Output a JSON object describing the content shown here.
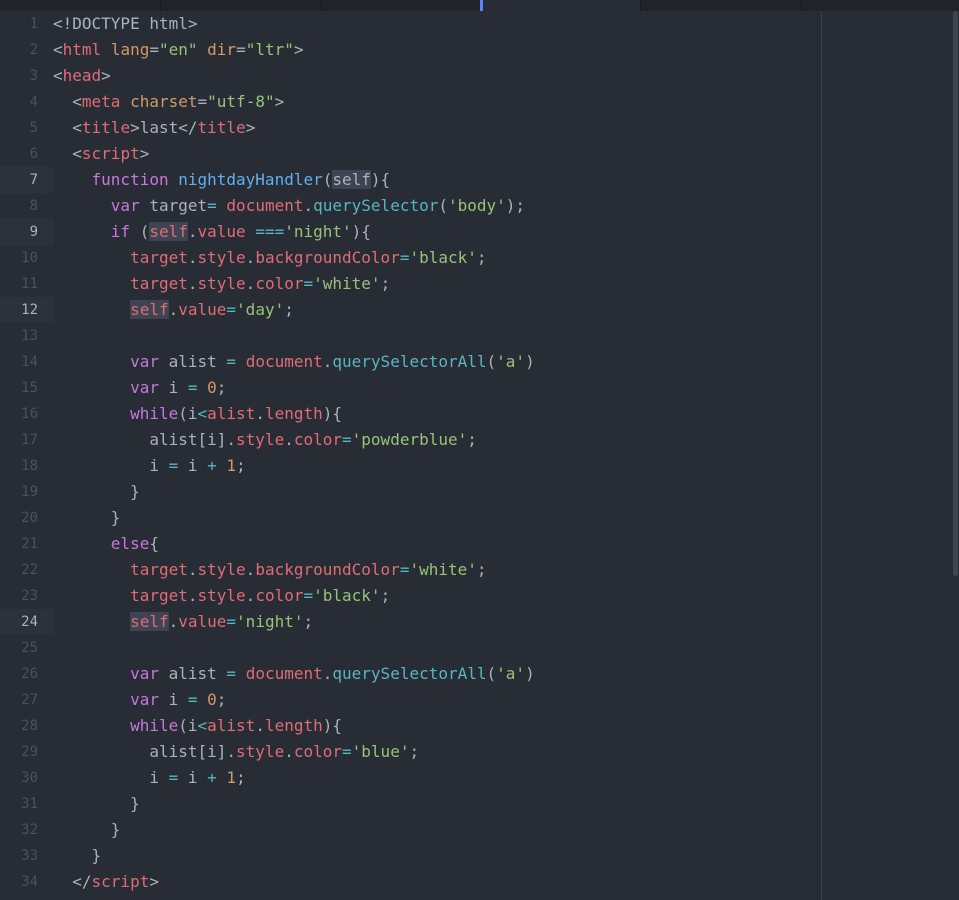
{
  "colors": {
    "background": "#282c34",
    "tag": "#e06c75",
    "attribute": "#d19a66",
    "string": "#98c379",
    "keyword": "#c678dd",
    "function": "#61afef",
    "method": "#56b6c2",
    "text": "#abb2bf",
    "line_number": "#495162",
    "selection": "#3e4451"
  },
  "lines": [
    {
      "n": "1",
      "hl": false,
      "tokens": [
        [
          "p",
          "<!DOCTYPE html>"
        ]
      ]
    },
    {
      "n": "2",
      "hl": false,
      "tokens": [
        [
          "p",
          "<"
        ],
        [
          "tag",
          "html"
        ],
        [
          "p",
          " "
        ],
        [
          "attr",
          "lang"
        ],
        [
          "p",
          "="
        ],
        [
          "str",
          "\"en\""
        ],
        [
          "p",
          " "
        ],
        [
          "attr",
          "dir"
        ],
        [
          "p",
          "="
        ],
        [
          "str",
          "\"ltr\""
        ],
        [
          "p",
          ">"
        ]
      ]
    },
    {
      "n": "3",
      "hl": false,
      "tokens": [
        [
          "p",
          "<"
        ],
        [
          "tag",
          "head"
        ],
        [
          "p",
          ">"
        ]
      ]
    },
    {
      "n": "4",
      "hl": false,
      "tokens": [
        [
          "p",
          "  <"
        ],
        [
          "tag",
          "meta"
        ],
        [
          "p",
          " "
        ],
        [
          "attr",
          "charset"
        ],
        [
          "p",
          "="
        ],
        [
          "str",
          "\"utf-8\""
        ],
        [
          "p",
          ">"
        ]
      ]
    },
    {
      "n": "5",
      "hl": false,
      "tokens": [
        [
          "p",
          "  <"
        ],
        [
          "tag",
          "title"
        ],
        [
          "p",
          ">last</"
        ],
        [
          "tag",
          "title"
        ],
        [
          "p",
          ">"
        ]
      ]
    },
    {
      "n": "6",
      "hl": false,
      "tokens": [
        [
          "p",
          "  <"
        ],
        [
          "tag",
          "script"
        ],
        [
          "p",
          ">"
        ]
      ]
    },
    {
      "n": "7",
      "hl": true,
      "tokens": [
        [
          "p",
          "    "
        ],
        [
          "kw",
          "function"
        ],
        [
          "p",
          " "
        ],
        [
          "fn",
          "nightdayHandler"
        ],
        [
          "p",
          "("
        ],
        [
          "selp",
          "self"
        ],
        [
          "p",
          "){"
        ]
      ]
    },
    {
      "n": "8",
      "hl": false,
      "tokens": [
        [
          "p",
          "      "
        ],
        [
          "kw",
          "var"
        ],
        [
          "p",
          " target"
        ],
        [
          "op",
          "="
        ],
        [
          "p",
          " "
        ],
        [
          "prop",
          "document"
        ],
        [
          "p",
          "."
        ],
        [
          "met",
          "querySelector"
        ],
        [
          "p",
          "("
        ],
        [
          "str",
          "'body'"
        ],
        [
          "p",
          ");"
        ]
      ]
    },
    {
      "n": "9",
      "hl": true,
      "tokens": [
        [
          "p",
          "      "
        ],
        [
          "kw",
          "if"
        ],
        [
          "p",
          " ("
        ],
        [
          "self",
          "self"
        ],
        [
          "p",
          "."
        ],
        [
          "prop",
          "value"
        ],
        [
          "p",
          " "
        ],
        [
          "op",
          "==="
        ],
        [
          "str",
          "'night'"
        ],
        [
          "p",
          "){"
        ]
      ]
    },
    {
      "n": "10",
      "hl": false,
      "tokens": [
        [
          "p",
          "        "
        ],
        [
          "prop",
          "target"
        ],
        [
          "p",
          "."
        ],
        [
          "prop",
          "style"
        ],
        [
          "p",
          "."
        ],
        [
          "prop",
          "backgroundColor"
        ],
        [
          "op",
          "="
        ],
        [
          "str",
          "'black'"
        ],
        [
          "p",
          ";"
        ]
      ]
    },
    {
      "n": "11",
      "hl": false,
      "tokens": [
        [
          "p",
          "        "
        ],
        [
          "prop",
          "target"
        ],
        [
          "p",
          "."
        ],
        [
          "prop",
          "style"
        ],
        [
          "p",
          "."
        ],
        [
          "prop",
          "color"
        ],
        [
          "op",
          "="
        ],
        [
          "str",
          "'white'"
        ],
        [
          "p",
          ";"
        ]
      ]
    },
    {
      "n": "12",
      "hl": true,
      "tokens": [
        [
          "p",
          "        "
        ],
        [
          "self",
          "self"
        ],
        [
          "p",
          "."
        ],
        [
          "prop",
          "value"
        ],
        [
          "op",
          "="
        ],
        [
          "str",
          "'day'"
        ],
        [
          "p",
          ";"
        ]
      ]
    },
    {
      "n": "13",
      "hl": false,
      "tokens": []
    },
    {
      "n": "14",
      "hl": false,
      "tokens": [
        [
          "p",
          "        "
        ],
        [
          "kw",
          "var"
        ],
        [
          "p",
          " alist "
        ],
        [
          "op",
          "="
        ],
        [
          "p",
          " "
        ],
        [
          "prop",
          "document"
        ],
        [
          "p",
          "."
        ],
        [
          "met",
          "querySelectorAll"
        ],
        [
          "p",
          "("
        ],
        [
          "str",
          "'a'"
        ],
        [
          "p",
          ")"
        ]
      ]
    },
    {
      "n": "15",
      "hl": false,
      "tokens": [
        [
          "p",
          "        "
        ],
        [
          "kw",
          "var"
        ],
        [
          "p",
          " i "
        ],
        [
          "op",
          "="
        ],
        [
          "p",
          " "
        ],
        [
          "num",
          "0"
        ],
        [
          "p",
          ";"
        ]
      ]
    },
    {
      "n": "16",
      "hl": false,
      "tokens": [
        [
          "p",
          "        "
        ],
        [
          "kw",
          "while"
        ],
        [
          "p",
          "(i"
        ],
        [
          "op",
          "<"
        ],
        [
          "prop",
          "alist"
        ],
        [
          "p",
          "."
        ],
        [
          "prop",
          "length"
        ],
        [
          "p",
          "){"
        ]
      ]
    },
    {
      "n": "17",
      "hl": false,
      "tokens": [
        [
          "p",
          "          alist[i]."
        ],
        [
          "prop",
          "style"
        ],
        [
          "p",
          "."
        ],
        [
          "prop",
          "color"
        ],
        [
          "op",
          "="
        ],
        [
          "str",
          "'powderblue'"
        ],
        [
          "p",
          ";"
        ]
      ]
    },
    {
      "n": "18",
      "hl": false,
      "tokens": [
        [
          "p",
          "          i "
        ],
        [
          "op",
          "="
        ],
        [
          "p",
          " i "
        ],
        [
          "op",
          "+"
        ],
        [
          "p",
          " "
        ],
        [
          "num",
          "1"
        ],
        [
          "p",
          ";"
        ]
      ]
    },
    {
      "n": "19",
      "hl": false,
      "tokens": [
        [
          "p",
          "        }"
        ]
      ]
    },
    {
      "n": "20",
      "hl": false,
      "tokens": [
        [
          "p",
          "      }"
        ]
      ]
    },
    {
      "n": "21",
      "hl": false,
      "tokens": [
        [
          "p",
          "      "
        ],
        [
          "kw",
          "else"
        ],
        [
          "p",
          "{"
        ]
      ]
    },
    {
      "n": "22",
      "hl": false,
      "tokens": [
        [
          "p",
          "        "
        ],
        [
          "prop",
          "target"
        ],
        [
          "p",
          "."
        ],
        [
          "prop",
          "style"
        ],
        [
          "p",
          "."
        ],
        [
          "prop",
          "backgroundColor"
        ],
        [
          "op",
          "="
        ],
        [
          "str",
          "'white'"
        ],
        [
          "p",
          ";"
        ]
      ]
    },
    {
      "n": "23",
      "hl": false,
      "tokens": [
        [
          "p",
          "        "
        ],
        [
          "prop",
          "target"
        ],
        [
          "p",
          "."
        ],
        [
          "prop",
          "style"
        ],
        [
          "p",
          "."
        ],
        [
          "prop",
          "color"
        ],
        [
          "op",
          "="
        ],
        [
          "str",
          "'black'"
        ],
        [
          "p",
          ";"
        ]
      ]
    },
    {
      "n": "24",
      "hl": true,
      "tokens": [
        [
          "p",
          "        "
        ],
        [
          "self",
          "self"
        ],
        [
          "p",
          "."
        ],
        [
          "prop",
          "value"
        ],
        [
          "op",
          "="
        ],
        [
          "str",
          "'night'"
        ],
        [
          "p",
          ";"
        ]
      ]
    },
    {
      "n": "25",
      "hl": false,
      "tokens": []
    },
    {
      "n": "26",
      "hl": false,
      "tokens": [
        [
          "p",
          "        "
        ],
        [
          "kw",
          "var"
        ],
        [
          "p",
          " alist "
        ],
        [
          "op",
          "="
        ],
        [
          "p",
          " "
        ],
        [
          "prop",
          "document"
        ],
        [
          "p",
          "."
        ],
        [
          "met",
          "querySelectorAll"
        ],
        [
          "p",
          "("
        ],
        [
          "str",
          "'a'"
        ],
        [
          "p",
          ")"
        ]
      ]
    },
    {
      "n": "27",
      "hl": false,
      "tokens": [
        [
          "p",
          "        "
        ],
        [
          "kw",
          "var"
        ],
        [
          "p",
          " i "
        ],
        [
          "op",
          "="
        ],
        [
          "p",
          " "
        ],
        [
          "num",
          "0"
        ],
        [
          "p",
          ";"
        ]
      ]
    },
    {
      "n": "28",
      "hl": false,
      "tokens": [
        [
          "p",
          "        "
        ],
        [
          "kw",
          "while"
        ],
        [
          "p",
          "(i"
        ],
        [
          "op",
          "<"
        ],
        [
          "prop",
          "alist"
        ],
        [
          "p",
          "."
        ],
        [
          "prop",
          "length"
        ],
        [
          "p",
          "){"
        ]
      ]
    },
    {
      "n": "29",
      "hl": false,
      "tokens": [
        [
          "p",
          "          alist[i]."
        ],
        [
          "prop",
          "style"
        ],
        [
          "p",
          "."
        ],
        [
          "prop",
          "color"
        ],
        [
          "op",
          "="
        ],
        [
          "str",
          "'blue'"
        ],
        [
          "p",
          ";"
        ]
      ]
    },
    {
      "n": "30",
      "hl": false,
      "tokens": [
        [
          "p",
          "          i "
        ],
        [
          "op",
          "="
        ],
        [
          "p",
          " i "
        ],
        [
          "op",
          "+"
        ],
        [
          "p",
          " "
        ],
        [
          "num",
          "1"
        ],
        [
          "p",
          ";"
        ]
      ]
    },
    {
      "n": "31",
      "hl": false,
      "tokens": [
        [
          "p",
          "        }"
        ]
      ]
    },
    {
      "n": "32",
      "hl": false,
      "tokens": [
        [
          "p",
          "      }"
        ]
      ]
    },
    {
      "n": "33",
      "hl": false,
      "tokens": [
        [
          "p",
          "    }"
        ]
      ]
    },
    {
      "n": "34",
      "hl": false,
      "tokens": [
        [
          "p",
          "  </"
        ],
        [
          "tag",
          "script"
        ],
        [
          "p",
          ">"
        ]
      ]
    }
  ]
}
